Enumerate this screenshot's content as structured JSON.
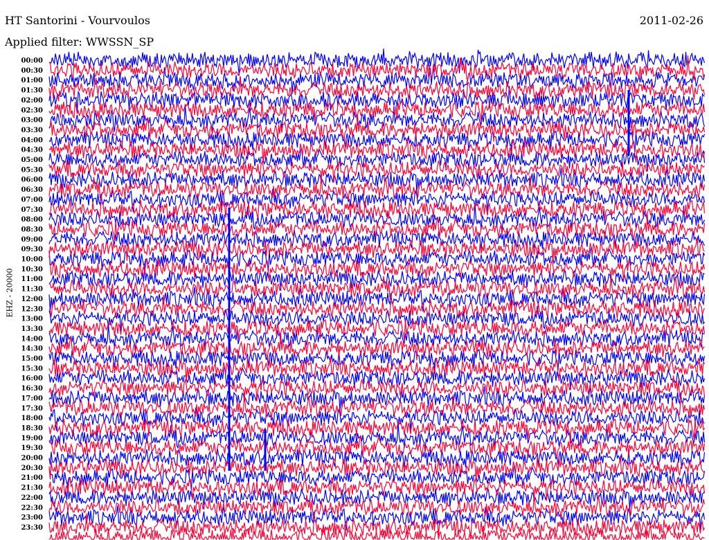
{
  "header": {
    "title": "HT Santorini - Vourvoulos",
    "date": "2011-02-26",
    "filter": "Applied filter: WWSSN_SP"
  },
  "chart_data": {
    "type": "line",
    "title": "HT Santorini - Vourvoulos",
    "date": "2011-02-26",
    "ylabel": "EHZ - 20000",
    "yticks": [
      "00:00",
      "00:30",
      "01:00",
      "01:30",
      "02:00",
      "02:30",
      "03:00",
      "03:30",
      "04:00",
      "04:30",
      "05:00",
      "05:30",
      "06:00",
      "06:30",
      "07:00",
      "07:30",
      "08:00",
      "08:30",
      "09:00",
      "09:30",
      "10:00",
      "10:30",
      "11:00",
      "11:30",
      "12:00",
      "12:30",
      "13:00",
      "13:30",
      "14:00",
      "14:30",
      "15:00",
      "15:30",
      "16:00",
      "16:30",
      "17:00",
      "17:30",
      "18:00",
      "18:30",
      "19:00",
      "19:30",
      "20:00",
      "20:30",
      "21:00",
      "21:30",
      "22:00",
      "22:30",
      "23:00",
      "23:30"
    ],
    "trace_colors": [
      "#0000ff",
      "#ff0033"
    ],
    "grid": false
  }
}
